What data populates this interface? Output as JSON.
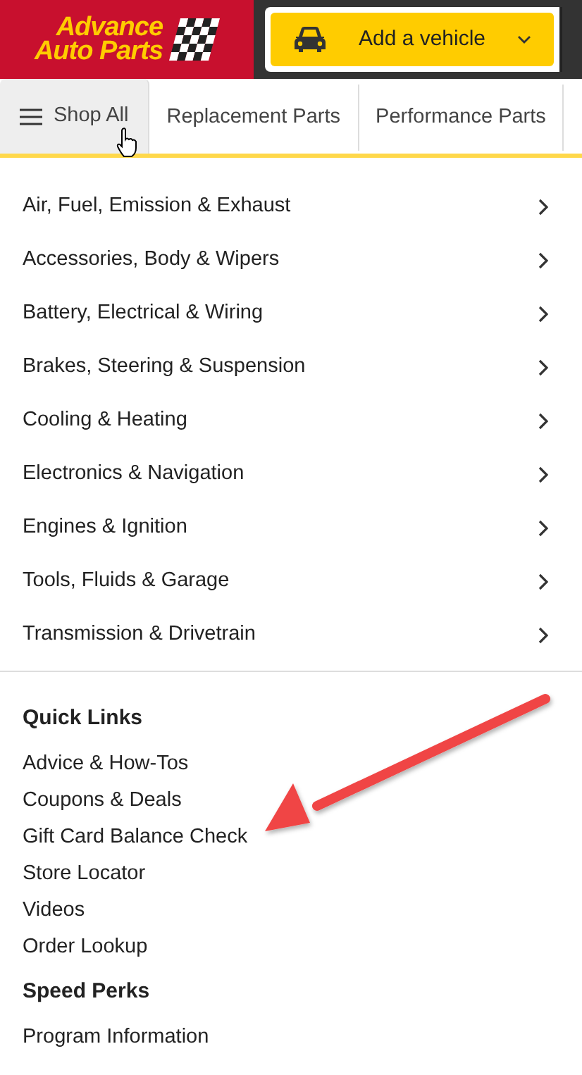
{
  "logo": {
    "lines": [
      "Advance",
      "Auto Parts"
    ]
  },
  "vehicle_button": {
    "label": "Add a vehicle"
  },
  "nav_tabs": [
    {
      "label": "Shop All",
      "kind": "menu",
      "selected": true
    },
    {
      "label": "Replacement Parts",
      "kind": "plain",
      "selected": false
    },
    {
      "label": "Performance Parts",
      "kind": "plain",
      "selected": false
    }
  ],
  "categories": [
    "Air, Fuel, Emission & Exhaust",
    "Accessories, Body & Wipers",
    "Battery, Electrical & Wiring",
    "Brakes, Steering & Suspension",
    "Cooling & Heating",
    "Electronics & Navigation",
    "Engines & Ignition",
    "Tools, Fluids & Garage",
    "Transmission & Drivetrain"
  ],
  "sections": [
    {
      "heading": "Quick Links",
      "links": [
        "Advice & How-Tos",
        "Coupons & Deals",
        "Gift Card Balance Check",
        "Store Locator",
        "Videos",
        "Order Lookup"
      ]
    },
    {
      "heading": "Speed Perks",
      "links": [
        "Program Information"
      ]
    }
  ]
}
